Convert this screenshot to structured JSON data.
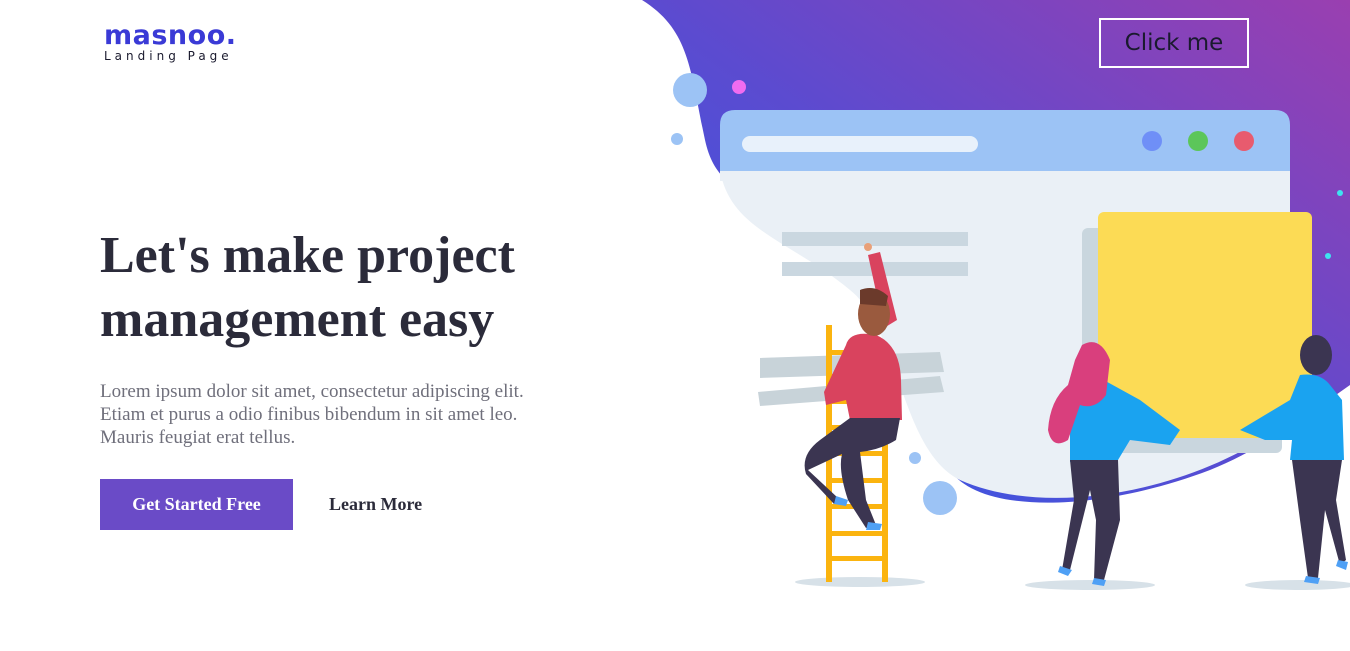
{
  "brand": {
    "name": "masnoo.",
    "tagline": "Landing Page",
    "accent_color": "#3a3ad6"
  },
  "header": {
    "cta_label": "Click me"
  },
  "hero": {
    "headline": "Let's make project management easy",
    "description": "Lorem ipsum dolor sit amet, consectetur adipiscing elit. Etiam et purus a odio finibus bibendum in sit amet leo. Mauris feugiat erat tellus.",
    "primary_button": "Get Started Free",
    "secondary_button": "Learn More",
    "primary_color": "#6a4bc7"
  },
  "illustration": {
    "gradient_colors": [
      "#9a3fb0",
      "#5b4bd0",
      "#2f5be8"
    ],
    "browser_dot_colors": [
      "#6f8ff7",
      "#5cc65a",
      "#e85b6e"
    ],
    "sticky_note_color": "#fcdb55"
  }
}
